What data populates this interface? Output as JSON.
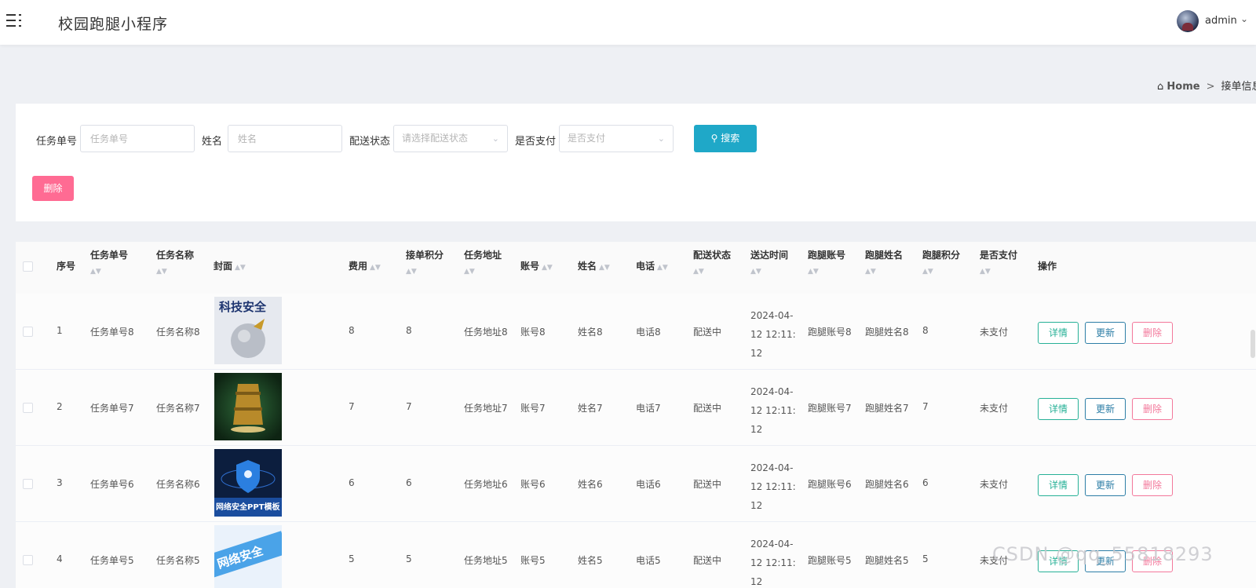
{
  "header": {
    "title": "校园跑腿小程序",
    "username": "admin",
    "caret": "⌄"
  },
  "breadcrumb": {
    "home": "Home",
    "separator": ">",
    "current": "接单信息"
  },
  "search": {
    "task_no_label": "任务单号",
    "task_no_placeholder": "任务单号",
    "name_label": "姓名",
    "name_placeholder": "姓名",
    "delivery_label": "配送状态",
    "delivery_placeholder": "请选择配送状态",
    "paid_label": "是否支付",
    "paid_placeholder": "是否支付",
    "search_button": "搜索",
    "delete_button": "删除"
  },
  "table": {
    "columns": [
      "序号",
      "任务单号",
      "任务名称",
      "封面",
      "费用",
      "接单积分",
      "任务地址",
      "账号",
      "姓名",
      "电话",
      "配送状态",
      "送达时间",
      "跑腿账号",
      "跑腿姓名",
      "跑腿积分",
      "是否支付",
      "操作"
    ],
    "rows": [
      {
        "index": "1",
        "task_no": "任务单号8",
        "task_name": "任务名称8",
        "fee": "8",
        "points": "8",
        "address": "任务地址8",
        "account": "账号8",
        "name": "姓名8",
        "phone": "电话8",
        "status": "配送中",
        "time_l1": "2024-04-",
        "time_l2": "12 12:11:",
        "time_l3": "12",
        "runner_account": "跑腿账号8",
        "runner_name": "跑腿姓名8",
        "runner_points": "8",
        "paid": "未支付",
        "cover_text": "科技安全"
      },
      {
        "index": "2",
        "task_no": "任务单号7",
        "task_name": "任务名称7",
        "fee": "7",
        "points": "7",
        "address": "任务地址7",
        "account": "账号7",
        "name": "姓名7",
        "phone": "电话7",
        "status": "配送中",
        "time_l1": "2024-04-",
        "time_l2": "12 12:11:",
        "time_l3": "12",
        "runner_account": "跑腿账号7",
        "runner_name": "跑腿姓名7",
        "runner_points": "7",
        "paid": "未支付",
        "cover_text": ""
      },
      {
        "index": "3",
        "task_no": "任务单号6",
        "task_name": "任务名称6",
        "fee": "6",
        "points": "6",
        "address": "任务地址6",
        "account": "账号6",
        "name": "姓名6",
        "phone": "电话6",
        "status": "配送中",
        "time_l1": "2024-04-",
        "time_l2": "12 12:11:",
        "time_l3": "12",
        "runner_account": "跑腿账号6",
        "runner_name": "跑腿姓名6",
        "runner_points": "6",
        "paid": "未支付",
        "cover_text": "网络安全PPT模板"
      },
      {
        "index": "4",
        "task_no": "任务单号5",
        "task_name": "任务名称5",
        "fee": "5",
        "points": "5",
        "address": "任务地址5",
        "account": "账号5",
        "name": "姓名5",
        "phone": "电话5",
        "status": "配送中",
        "time_l1": "2024-04-",
        "time_l2": "12 12:11:",
        "time_l3": "12",
        "runner_account": "跑腿账号5",
        "runner_name": "跑腿姓名5",
        "runner_points": "5",
        "paid": "未支付",
        "cover_text": "网络安全"
      }
    ],
    "actions": {
      "detail": "详情",
      "update": "更新",
      "delete": "删除"
    }
  },
  "watermark": "CSDN @qq_55818293",
  "colors": {
    "accent": "#1fa8c8",
    "danger": "#ff6b93",
    "detail": "#27b197",
    "update": "#2d7ea6"
  }
}
